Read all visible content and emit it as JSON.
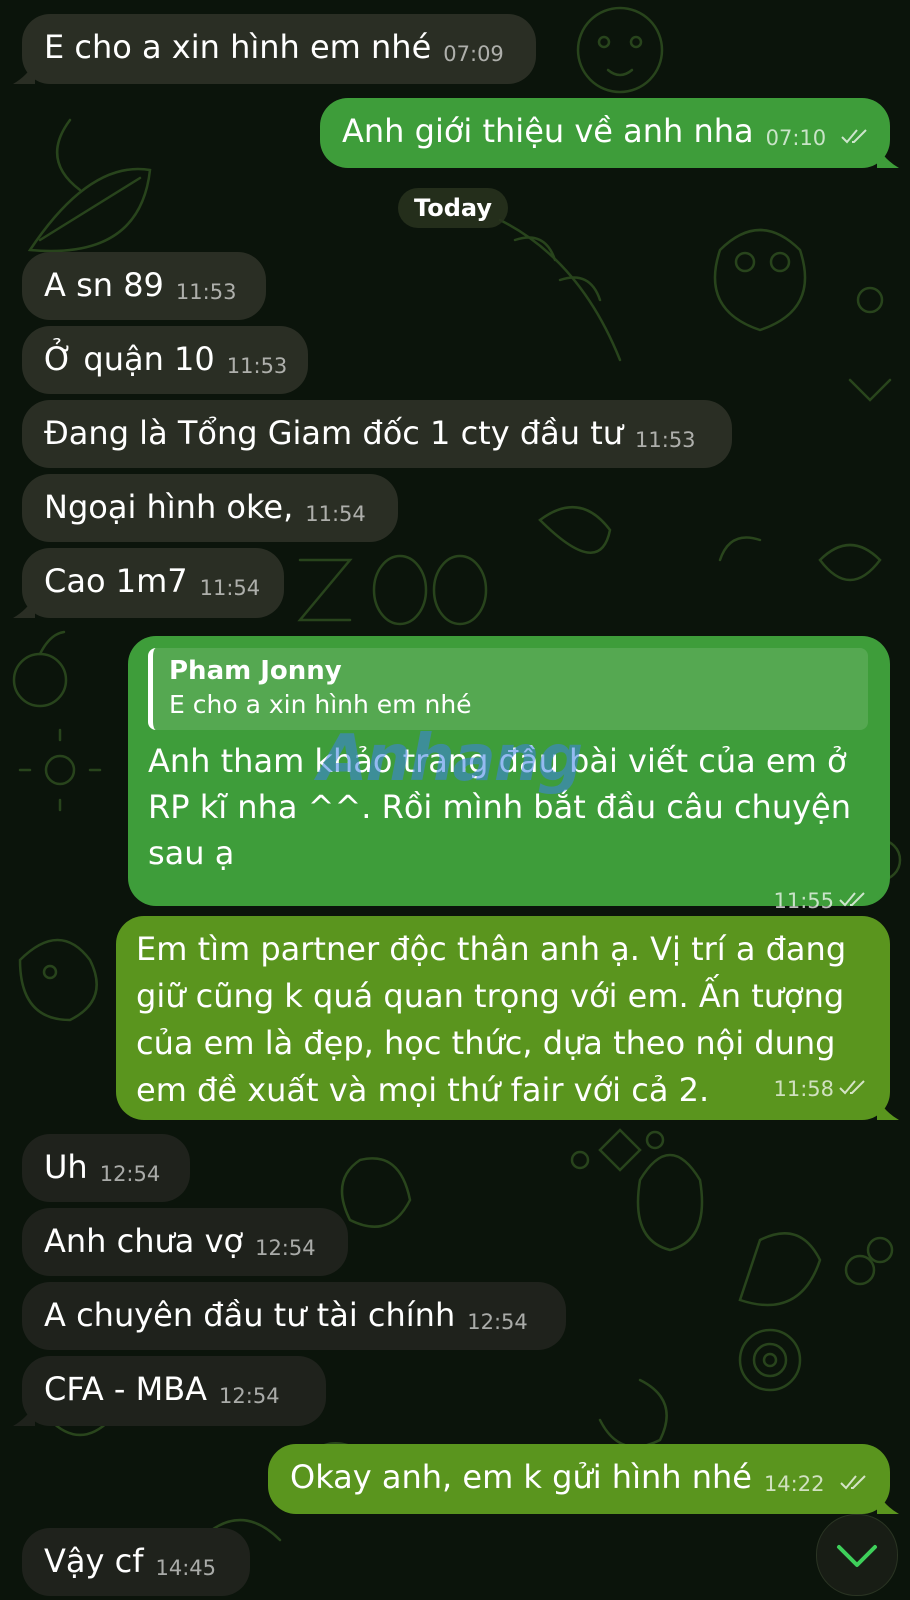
{
  "date_separator": "Today",
  "messages": [
    {
      "text": "E cho a xin hình em nhé",
      "time": "07:09"
    },
    {
      "text": "Anh giới thiệu về anh nha",
      "time": "07:10"
    },
    {
      "text": "A sn 89",
      "time": "11:53"
    },
    {
      "text": "Ở quận 10",
      "time": "11:53"
    },
    {
      "text": "Đang là Tổng Giam đốc 1 cty đầu tư",
      "time": "11:53"
    },
    {
      "text": "Ngoại hình oke,",
      "time": "11:54"
    },
    {
      "text": "Cao 1m7",
      "time": "11:54"
    },
    {
      "reply_name": "Pham Jonny",
      "reply_text": "E cho a xin hình em nhé",
      "text": "Anh tham khảo trang đầu bài viết của em ở RP kĩ nha ^^. Rồi mình bắt đầu câu chuyện sau ạ",
      "time": "11:55"
    },
    {
      "text": "Em tìm partner độc thân anh ạ. Vị trí a đang giữ cũng k quá quan trọng với em. Ấn tượng của em là đẹp, học thức, dựa theo nội dung em đề xuất và mọi thứ fair với cả 2.",
      "time": "11:58"
    },
    {
      "text": "Uh",
      "time": "12:54"
    },
    {
      "text": "Anh chưa vợ",
      "time": "12:54"
    },
    {
      "text": "A chuyên đầu tư tài chính",
      "time": "12:54"
    },
    {
      "text": "CFA - MBA",
      "time": "12:54"
    },
    {
      "text": "Okay anh, em k gửi hình nhé",
      "time": "14:22"
    },
    {
      "text": "Vậy cf",
      "time": "14:45"
    }
  ],
  "watermark": "Anhang",
  "icons": {
    "read": "double-check-icon",
    "scroll": "chevron-down-icon"
  },
  "colors": {
    "incoming": "#2a2e24",
    "outgoing": "#3e9d3a",
    "outgoing_olive": "#5a951e",
    "background": "#0b140b"
  }
}
